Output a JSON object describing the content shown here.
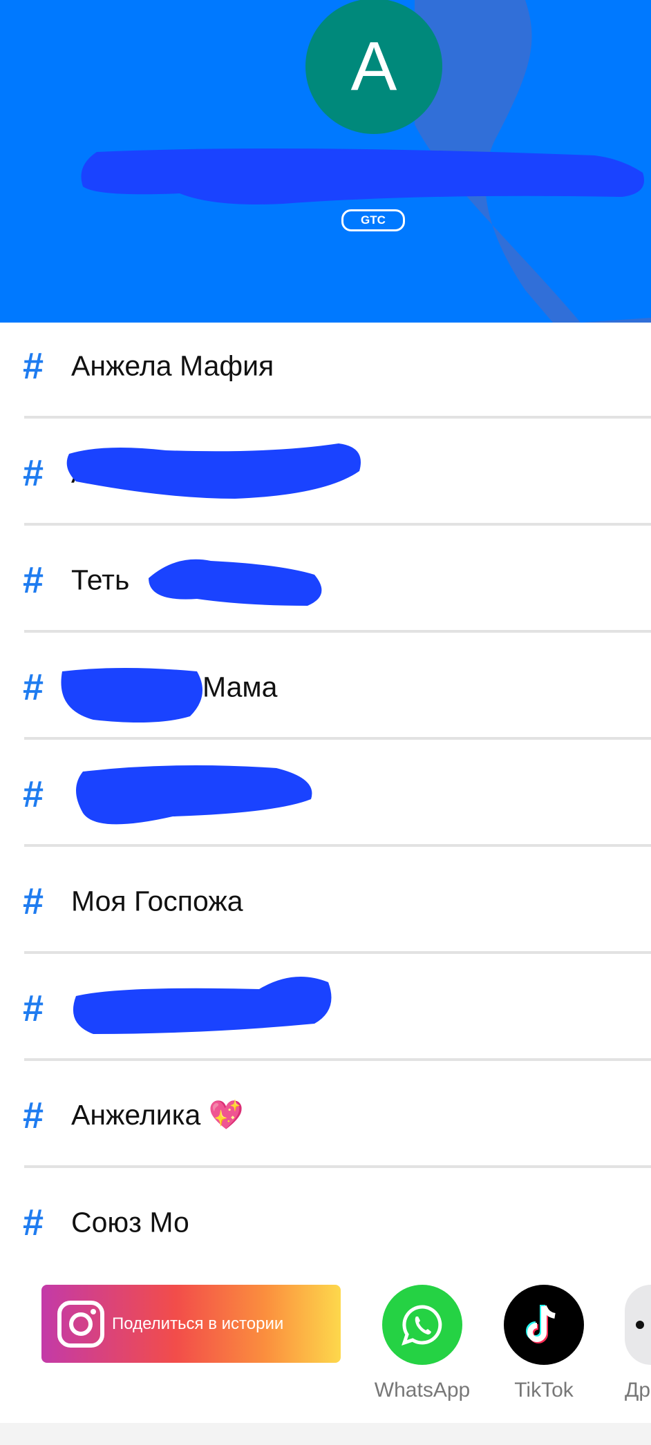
{
  "header": {
    "avatar_letter": "A",
    "badge": "GTC",
    "background_color": "#0079ff",
    "avatar_color": "#00897b"
  },
  "contacts": [
    {
      "label": "Анжела Мафия"
    },
    {
      "label": "А"
    },
    {
      "label": "Теть"
    },
    {
      "label": "Мама"
    },
    {
      "label": ""
    },
    {
      "label": "Моя Госпожа"
    },
    {
      "label": ""
    },
    {
      "label": "Анжелика 💖"
    },
    {
      "label": "Союз Мо"
    }
  ],
  "hash_symbol": "#",
  "share": {
    "instagram_label": "Поделиться в истории",
    "whatsapp_label": "WhatsApp",
    "tiktok_label": "TikTok",
    "more_label": "Др"
  }
}
